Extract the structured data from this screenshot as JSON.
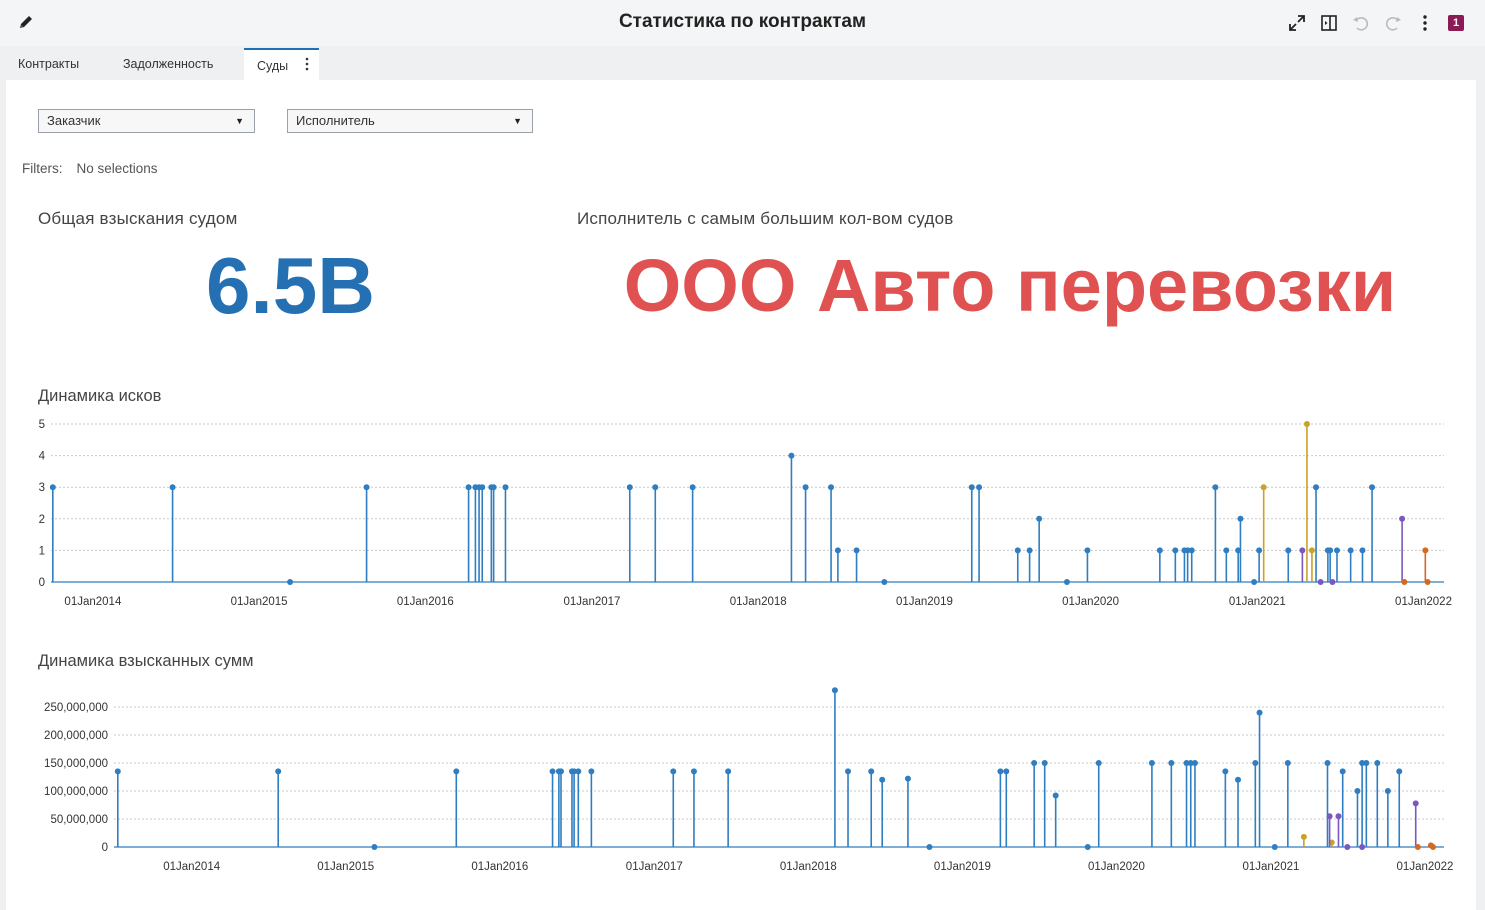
{
  "header": {
    "title": "Статистика по контрактам",
    "badge": "1"
  },
  "tabs": [
    {
      "label": "Контракты"
    },
    {
      "label": "Задолженность"
    },
    {
      "label": "Суды"
    }
  ],
  "filters": {
    "customer_dropdown": "Заказчик",
    "executor_dropdown": "Исполнитель",
    "label": "Filters:",
    "value": "No selections"
  },
  "kpis": {
    "total": {
      "label": "Общая взыскания судом",
      "value": "6.5B",
      "color": "#2470b3"
    },
    "top_executor": {
      "label": "Исполнитель с самым большим кол-вом судов",
      "value": "ООО Авто перевозки",
      "color": "#e05252"
    }
  },
  "colors": {
    "blue": "#2f7ec1",
    "gold": "#c9a227",
    "purple": "#7b57c2",
    "orange": "#d4691f"
  },
  "chart_data": [
    {
      "type": "line",
      "subtype": "needle",
      "title": "Динамика исков",
      "xlim": [
        "2013-10-01",
        "2022-02-15"
      ],
      "ylim": [
        0,
        5
      ],
      "yticks": [
        "0",
        "1",
        "2",
        "3",
        "4",
        "5"
      ],
      "xticks": [
        {
          "date": "2014-01-01",
          "label": "01Jan2014"
        },
        {
          "date": "2015-01-01",
          "label": "01Jan2015"
        },
        {
          "date": "2016-01-01",
          "label": "01Jan2016"
        },
        {
          "date": "2017-01-01",
          "label": "01Jan2017"
        },
        {
          "date": "2018-01-01",
          "label": "01Jan2018"
        },
        {
          "date": "2019-01-01",
          "label": "01Jan2019"
        },
        {
          "date": "2020-01-01",
          "label": "01Jan2020"
        },
        {
          "date": "2021-01-01",
          "label": "01Jan2021"
        },
        {
          "date": "2022-01-01",
          "label": "01Jan2022"
        }
      ],
      "grid": true,
      "series": [
        {
          "color": "#2f7ec1",
          "points": [
            [
              "2013-10-05",
              3
            ],
            [
              "2014-06-25",
              3
            ],
            [
              "2015-03-10",
              0
            ],
            [
              "2015-08-25",
              3
            ],
            [
              "2016-04-05",
              3
            ],
            [
              "2016-04-20",
              3
            ],
            [
              "2016-04-28",
              3
            ],
            [
              "2016-05-05",
              3
            ],
            [
              "2016-05-25",
              3
            ],
            [
              "2016-05-30",
              3
            ],
            [
              "2016-06-25",
              3
            ],
            [
              "2017-03-25",
              3
            ],
            [
              "2017-05-20",
              3
            ],
            [
              "2017-08-10",
              3
            ],
            [
              "2018-03-15",
              4
            ],
            [
              "2018-04-15",
              3
            ],
            [
              "2018-06-10",
              3
            ],
            [
              "2018-06-25",
              1
            ],
            [
              "2018-08-05",
              1
            ],
            [
              "2018-10-05",
              0
            ],
            [
              "2019-04-15",
              3
            ],
            [
              "2019-05-01",
              3
            ],
            [
              "2019-07-25",
              1
            ],
            [
              "2019-08-20",
              1
            ],
            [
              "2019-09-10",
              2
            ],
            [
              "2019-11-10",
              0
            ],
            [
              "2019-12-25",
              1
            ],
            [
              "2020-06-01",
              1
            ],
            [
              "2020-07-05",
              1
            ],
            [
              "2020-07-25",
              1
            ],
            [
              "2020-08-01",
              1
            ],
            [
              "2020-08-10",
              1
            ],
            [
              "2020-10-01",
              3
            ],
            [
              "2020-10-25",
              1
            ],
            [
              "2020-11-20",
              1
            ],
            [
              "2020-11-25",
              2
            ],
            [
              "2020-12-25",
              0
            ],
            [
              "2021-01-05",
              1
            ],
            [
              "2021-03-10",
              1
            ],
            [
              "2021-05-10",
              3
            ],
            [
              "2021-06-05",
              1
            ],
            [
              "2021-06-10",
              1
            ],
            [
              "2021-06-25",
              1
            ],
            [
              "2021-07-25",
              1
            ],
            [
              "2021-08-20",
              1
            ],
            [
              "2021-09-10",
              3
            ]
          ]
        },
        {
          "color": "#c9a227",
          "points": [
            [
              "2021-01-15",
              3
            ],
            [
              "2021-04-20",
              5
            ],
            [
              "2021-05-01",
              1
            ]
          ]
        },
        {
          "color": "#7b57c2",
          "points": [
            [
              "2021-04-10",
              1
            ],
            [
              "2021-05-20",
              0
            ],
            [
              "2021-06-15",
              0
            ],
            [
              "2021-11-15",
              2
            ]
          ]
        },
        {
          "color": "#d4691f",
          "points": [
            [
              "2021-11-20",
              0
            ],
            [
              "2022-01-05",
              1
            ],
            [
              "2022-01-10",
              0
            ]
          ]
        }
      ]
    },
    {
      "type": "line",
      "subtype": "needle",
      "title": "Динамика взысканных сумм",
      "xlim": [
        "2013-07-01",
        "2022-02-15"
      ],
      "ylim": [
        0,
        250000000
      ],
      "yticks": [
        "0",
        "50,000,000",
        "100,000,000",
        "150,000,000",
        "200,000,000",
        "250,000,000"
      ],
      "xticks": [
        {
          "date": "2014-01-01",
          "label": "01Jan2014"
        },
        {
          "date": "2015-01-01",
          "label": "01Jan2015"
        },
        {
          "date": "2016-01-01",
          "label": "01Jan2016"
        },
        {
          "date": "2017-01-01",
          "label": "01Jan2017"
        },
        {
          "date": "2018-01-01",
          "label": "01Jan2018"
        },
        {
          "date": "2019-01-01",
          "label": "01Jan2019"
        },
        {
          "date": "2020-01-01",
          "label": "01Jan2020"
        },
        {
          "date": "2021-01-01",
          "label": "01Jan2021"
        },
        {
          "date": "2022-01-01",
          "label": "01Jan2022"
        }
      ],
      "grid": true,
      "series": [
        {
          "color": "#2f7ec1",
          "points": [
            [
              "2013-07-10",
              135000000
            ],
            [
              "2014-07-25",
              135000000
            ],
            [
              "2015-03-10",
              0
            ],
            [
              "2015-09-20",
              135000000
            ],
            [
              "2016-05-05",
              135000000
            ],
            [
              "2016-05-20",
              135000000
            ],
            [
              "2016-05-25",
              135000000
            ],
            [
              "2016-06-20",
              135000000
            ],
            [
              "2016-06-25",
              135000000
            ],
            [
              "2016-07-05",
              135000000
            ],
            [
              "2016-08-05",
              135000000
            ],
            [
              "2017-02-15",
              135000000
            ],
            [
              "2017-04-05",
              135000000
            ],
            [
              "2017-06-25",
              135000000
            ],
            [
              "2018-03-05",
              280000000
            ],
            [
              "2018-04-05",
              135000000
            ],
            [
              "2018-05-30",
              135000000
            ],
            [
              "2018-06-25",
              120000000
            ],
            [
              "2018-08-25",
              122000000
            ],
            [
              "2018-10-15",
              0
            ],
            [
              "2019-04-01",
              135000000
            ],
            [
              "2019-04-15",
              135000000
            ],
            [
              "2019-06-20",
              150000000
            ],
            [
              "2019-07-15",
              150000000
            ],
            [
              "2019-08-10",
              92000000
            ],
            [
              "2019-10-25",
              0
            ],
            [
              "2019-11-20",
              150000000
            ],
            [
              "2020-03-25",
              150000000
            ],
            [
              "2020-05-10",
              150000000
            ],
            [
              "2020-06-15",
              150000000
            ],
            [
              "2020-06-25",
              150000000
            ],
            [
              "2020-07-05",
              150000000
            ],
            [
              "2020-09-15",
              135000000
            ],
            [
              "2020-10-15",
              120000000
            ],
            [
              "2020-11-25",
              150000000
            ],
            [
              "2020-12-05",
              240000000
            ],
            [
              "2021-01-10",
              0
            ],
            [
              "2021-02-10",
              150000000
            ],
            [
              "2021-05-15",
              150000000
            ],
            [
              "2021-06-20",
              135000000
            ],
            [
              "2021-07-25",
              100000000
            ],
            [
              "2021-08-05",
              150000000
            ],
            [
              "2021-08-15",
              150000000
            ],
            [
              "2021-09-10",
              150000000
            ],
            [
              "2021-10-05",
              100000000
            ],
            [
              "2021-11-01",
              135000000
            ]
          ]
        },
        {
          "color": "#c9a227",
          "points": [
            [
              "2021-03-20",
              18000000
            ],
            [
              "2021-05-25",
              8000000
            ]
          ]
        },
        {
          "color": "#7b57c2",
          "points": [
            [
              "2021-05-20",
              55000000
            ],
            [
              "2021-06-10",
              55000000
            ],
            [
              "2021-07-01",
              0
            ],
            [
              "2021-08-05",
              0
            ],
            [
              "2021-12-10",
              78000000
            ]
          ]
        },
        {
          "color": "#d4691f",
          "points": [
            [
              "2021-12-15",
              0
            ],
            [
              "2022-01-15",
              3000000
            ],
            [
              "2022-01-20",
              0
            ]
          ]
        }
      ]
    }
  ]
}
